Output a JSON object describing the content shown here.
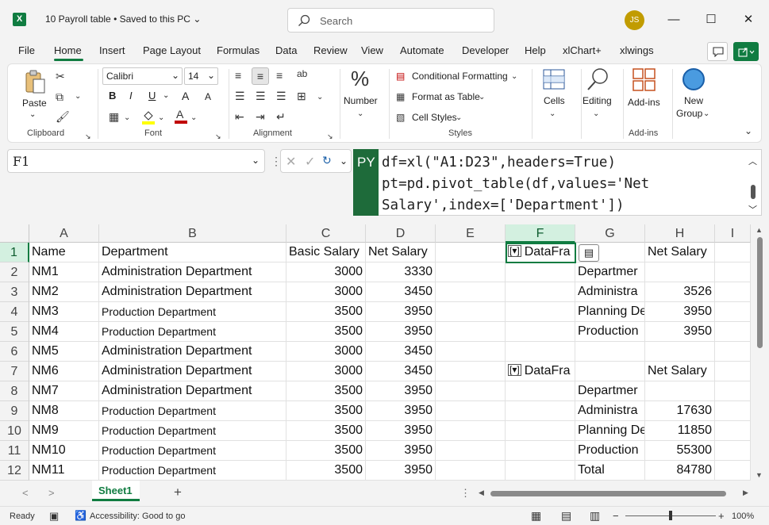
{
  "titlebar": {
    "app_icon": "X",
    "title": "10 Payroll table",
    "save_state": "• Saved to this PC",
    "search_placeholder": "Search",
    "user_initials": "JS",
    "minimize": "—",
    "maximize": "☐",
    "close": "✕"
  },
  "tabs": [
    "File",
    "Home",
    "Insert",
    "Page Layout",
    "Formulas",
    "Data",
    "Review",
    "View",
    "Automate",
    "Developer",
    "Help",
    "xlChart+",
    "xlwings"
  ],
  "active_tab": "Home",
  "ribbon": {
    "clipboard": {
      "paste": "Paste",
      "label": "Clipboard"
    },
    "font": {
      "family": "Calibri",
      "size": "14",
      "bold": "B",
      "italic": "I",
      "underline": "U",
      "grow": "A",
      "shrink": "A",
      "label": "Font"
    },
    "alignment": {
      "label": "Alignment"
    },
    "number": {
      "label": "Number"
    },
    "styles": {
      "conditional": "Conditional Formatting",
      "table": "Format as Table",
      "cell_styles": "Cell Styles",
      "label": "Styles"
    },
    "cells": {
      "label": "Cells"
    },
    "editing": {
      "label": "Editing"
    },
    "addins": {
      "button": "Add-ins",
      "label": "Add-ins"
    },
    "newgroup": {
      "line1": "New",
      "line2": "Group"
    },
    "accent": "#107c41"
  },
  "formula_bar": {
    "name_box": "F1",
    "badge": "PY",
    "lines": [
      "df=xl(\"A1:D23\",headers=True)",
      "pt=pd.pivot_table(df,values='Net",
      "Salary',index=['Department'])"
    ]
  },
  "grid": {
    "columns": [
      "A",
      "B",
      "C",
      "D",
      "E",
      "F",
      "G",
      "H",
      "I"
    ],
    "selected_column": "F",
    "selected_row": "1",
    "rows": [
      {
        "n": "1",
        "A": "Name",
        "B": "Department",
        "C": "Basic Salary",
        "D": "Net Salary",
        "E": "",
        "F": "DataFra",
        "G": "",
        "H": "Net Salary"
      },
      {
        "n": "2",
        "A": "NM1",
        "B": "Administration Department",
        "C": "3000",
        "D": "3330",
        "E": "",
        "F": "",
        "G": "Departmer",
        "H": ""
      },
      {
        "n": "3",
        "A": "NM2",
        "B": "Administration Department",
        "C": "3000",
        "D": "3450",
        "E": "",
        "F": "",
        "G": "Administra",
        "H": "3526"
      },
      {
        "n": "4",
        "A": "NM3",
        "B": "Production Department",
        "C": "3500",
        "D": "3950",
        "E": "",
        "F": "",
        "G": "Planning De",
        "H": "3950"
      },
      {
        "n": "5",
        "A": "NM4",
        "B": "Production Department",
        "C": "3500",
        "D": "3950",
        "E": "",
        "F": "",
        "G": "Production",
        "H": "3950"
      },
      {
        "n": "6",
        "A": "NM5",
        "B": "Administration Department",
        "C": "3000",
        "D": "3450",
        "E": "",
        "F": "",
        "G": "",
        "H": ""
      },
      {
        "n": "7",
        "A": "NM6",
        "B": "Administration Department",
        "C": "3000",
        "D": "3450",
        "E": "",
        "F": "DataFra",
        "G": "",
        "H": "Net Salary"
      },
      {
        "n": "8",
        "A": "NM7",
        "B": "Administration Department",
        "C": "3500",
        "D": "3950",
        "E": "",
        "F": "",
        "G": "Departmer",
        "H": ""
      },
      {
        "n": "9",
        "A": "NM8",
        "B": "Production Department",
        "C": "3500",
        "D": "3950",
        "E": "",
        "F": "",
        "G": "Administra",
        "H": "17630"
      },
      {
        "n": "10",
        "A": "NM9",
        "B": "Production Department",
        "C": "3500",
        "D": "3950",
        "E": "",
        "F": "",
        "G": "Planning De",
        "H": "11850"
      },
      {
        "n": "11",
        "A": "NM10",
        "B": "Production Department",
        "C": "3500",
        "D": "3950",
        "E": "",
        "F": "",
        "G": "Production",
        "H": "55300"
      },
      {
        "n": "12",
        "A": "NM11",
        "B": "Production Department",
        "C": "3500",
        "D": "3950",
        "E": "",
        "F": "",
        "G": "Total",
        "H": "84780"
      }
    ]
  },
  "sheetbar": {
    "prev": "<",
    "next": ">",
    "sheet": "Sheet1",
    "add": "+",
    "more": "⋮"
  },
  "status": {
    "ready": "Ready",
    "accessibility": "Accessibility: Good to go",
    "zoom": "100%"
  }
}
